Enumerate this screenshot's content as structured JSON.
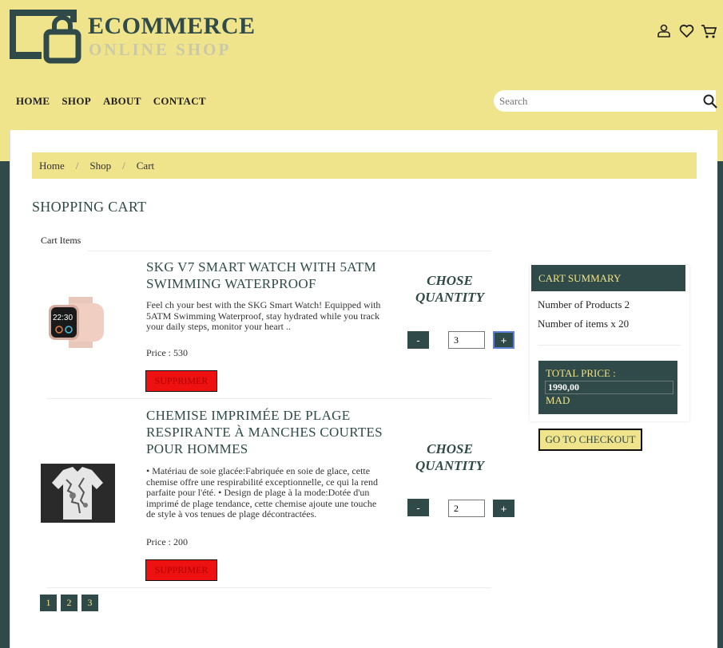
{
  "brand": {
    "name": "ECOMMERCE",
    "tagline": "ONLINE SHOP"
  },
  "nav": {
    "items": [
      "HOME",
      "SHOP",
      "ABOUT",
      "CONTACT"
    ]
  },
  "header_icons": [
    "user-icon",
    "heart-icon",
    "cart-icon"
  ],
  "search": {
    "placeholder": "Search"
  },
  "breadcrumb": {
    "items": [
      "Home",
      "Shop",
      "Cart"
    ],
    "separator": "/"
  },
  "page": {
    "title": "SHOPPING CART",
    "cart_items_label": "Cart Items"
  },
  "products": [
    {
      "title_line1": "SKG V7 SMART WATCH WITH 5ATM",
      "title_line2": "SWIMMING WATERPROOF",
      "desc": [
        "Feel ch your best with the SKG Smart Watch! Equipped with",
        "5ATM Swimming Waterproof, stay hydrated while you track",
        "your daily steps, monitor your heart .."
      ],
      "price": "Price : 530",
      "remove_label": "SUPPRIMER",
      "qty_title_1": "CHOSE",
      "qty_title_2": "QUANTITY",
      "quantity": "3",
      "minus": "-",
      "plus": "+"
    },
    {
      "title_line1": "CHEMISE IMPRIMÉE DE PLAGE",
      "title_line2": "RESPIRANTE À MANCHES COURTES",
      "title_line3": "POUR HOMMES",
      "desc": [
        "• Matériau de soie glacée:Fabriquée en soie de glace, cette",
        "chemise offre une respirabilité exceptionnelle, ce qui la rend",
        "parfaite pour l'été. • Design de plage à la mode:Dotée d'un",
        "imprimé de plage tendance, cette chemise ajoute une touche",
        "de style à vos tenues de plage décontractées."
      ],
      "price": "Price : 200",
      "remove_label": "SUPPRIMER",
      "qty_title_1": "CHOSE",
      "qty_title_2": "QUANTITY",
      "quantity": "2",
      "minus": "-",
      "plus": "+"
    }
  ],
  "summary": {
    "title": "CART SUMMARY",
    "products_line": "Number of Products 2",
    "items_line": "Number of items x 20",
    "total_label": "TOTAL PRICE :",
    "total_value": "1990,00",
    "currency": "MAD",
    "checkout_label": "GO TO CHECKOUT"
  },
  "pagination": {
    "pages": [
      "1",
      "2",
      "3"
    ]
  },
  "colors": {
    "accent_yellow": "#efe38c",
    "dark_green": "#2f4a48",
    "remove_red": "#ee1111"
  }
}
